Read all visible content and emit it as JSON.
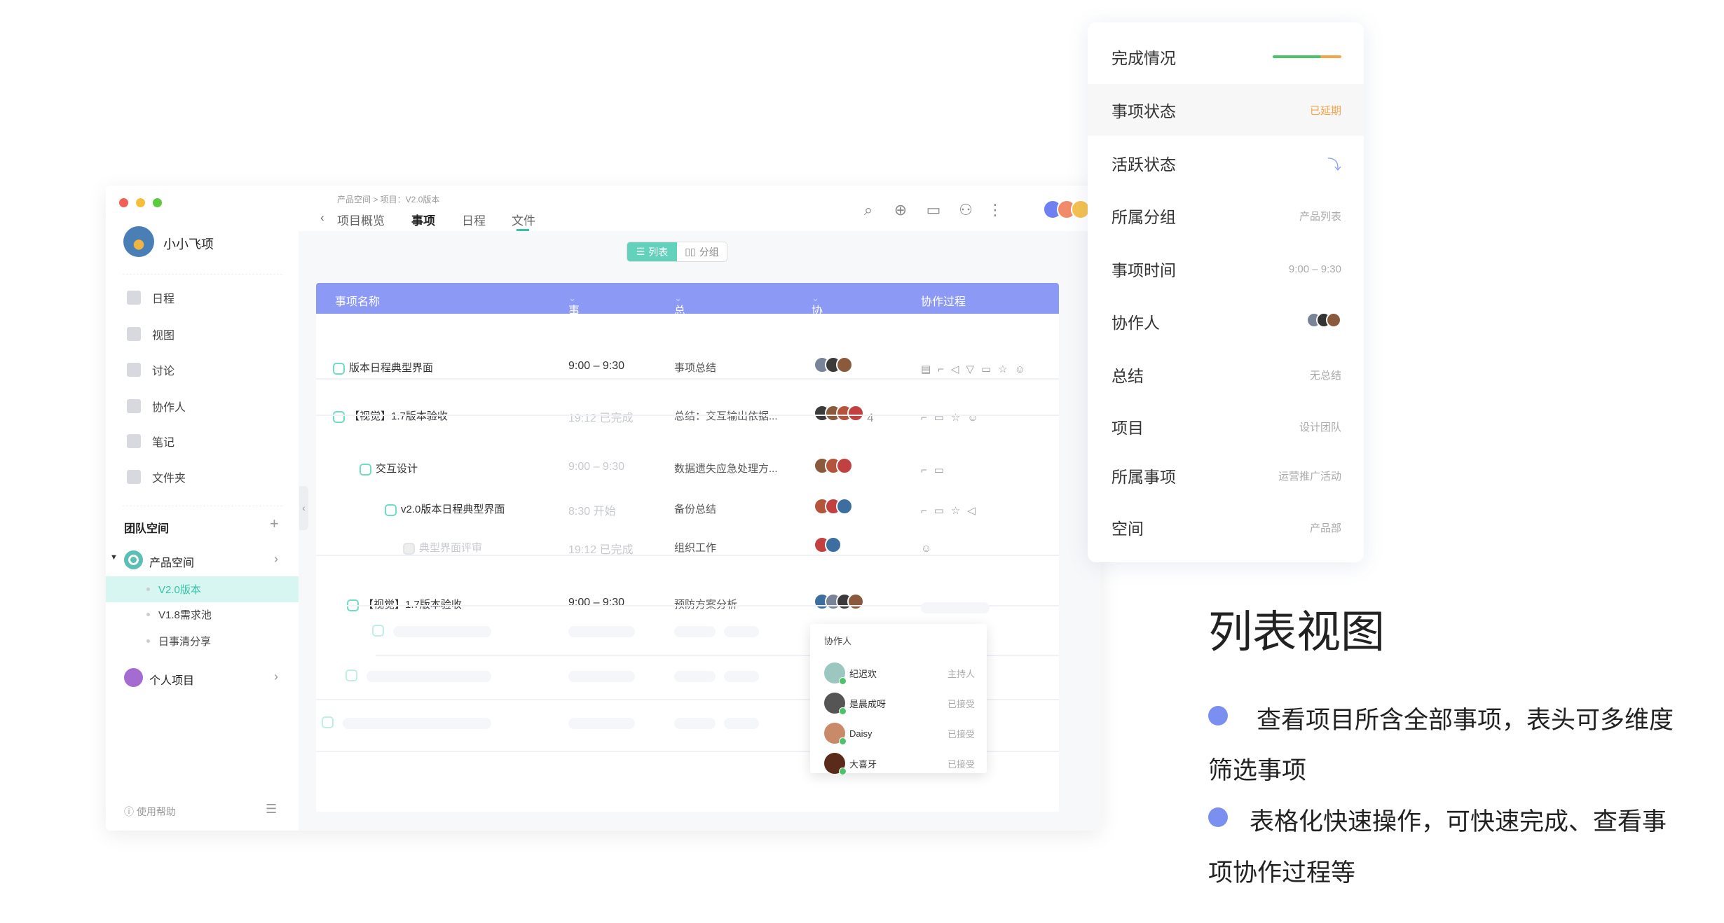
{
  "colors": {
    "accent": "#37c2a8",
    "header": "#8c9af5",
    "bullet": "#7b8ff0",
    "delayed": "#f5a54a"
  },
  "sidebar": {
    "user": "小小飞项",
    "nav": [
      {
        "label": "日程",
        "icon": "calendar-icon"
      },
      {
        "label": "视图",
        "icon": "chart-icon"
      },
      {
        "label": "讨论",
        "icon": "discussion-icon"
      },
      {
        "label": "协作人",
        "icon": "people-icon"
      },
      {
        "label": "笔记",
        "icon": "note-icon"
      },
      {
        "label": "文件夹",
        "icon": "folder-icon"
      }
    ],
    "team_title": "团队空间",
    "product_space": "产品空间",
    "sub": [
      "V2.0版本",
      "V1.8需求池",
      "日事清分享"
    ],
    "personal": "个人项目",
    "help": "使用帮助"
  },
  "header": {
    "breadcrumb": "产品空间 > 项目：V2.0版本",
    "tabs": [
      "项目概览",
      "事项",
      "日程",
      "文件"
    ],
    "active_tab": 1
  },
  "view_toggle": {
    "list": "列表",
    "group": "分组",
    "selected": "list"
  },
  "table": {
    "columns": [
      "事项名称",
      "事项时间",
      "总结",
      "协作人",
      "协作过程"
    ],
    "rows": [
      {
        "name": "版本日程典型界面",
        "time": "9:00 – 9:30",
        "time_muted": false,
        "summary": "事项总结",
        "avatars": 3,
        "extra": "",
        "icons": "▤⌐◁▽▭☆☺"
      },
      {
        "name": "【视觉】1.7版本验收",
        "time": "19:12 已完成",
        "time_muted": true,
        "summary": "总结：交互输出依据...",
        "avatars": 4,
        "extra": "4",
        "icons": "⌐▭☆☺"
      },
      {
        "name": "交互设计",
        "time": "9:00 – 9:30",
        "time_muted": true,
        "summary": "数据遗失应急处理方...",
        "avatars": 3,
        "extra": "",
        "icons": "⌐▭"
      },
      {
        "name": "v2.0版本日程典型界面",
        "time": "8:30 开始",
        "time_muted": true,
        "summary": "备份总结",
        "avatars": 3,
        "extra": "",
        "icons": "⌐▭☆◁"
      },
      {
        "name": "典型界面评审",
        "time": "19:12 已完成",
        "time_muted": true,
        "summary": "组织工作",
        "avatars": 2,
        "extra": "",
        "icons": "☺",
        "done": true
      },
      {
        "name": "【视觉】1.7版本验收",
        "time": "9:00 – 9:30",
        "time_muted": false,
        "summary": "预防方案分析",
        "avatars": 4,
        "extra": "",
        "icons": ""
      }
    ]
  },
  "popup": {
    "title": "协作人",
    "people": [
      {
        "name": "纪迟欢",
        "role": "主持人"
      },
      {
        "name": "是晨成呀",
        "role": "已接受"
      },
      {
        "name": "Daisy",
        "role": "已接受"
      },
      {
        "name": "大喜牙",
        "role": "已接受"
      }
    ]
  },
  "panel": {
    "progress": {
      "label": "完成情况",
      "complete_fraction": 0.7
    },
    "rows": [
      {
        "label": "事项状态",
        "value": "已延期"
      },
      {
        "label": "活跃状态",
        "value": ""
      },
      {
        "label": "所属分组",
        "value": "产品列表"
      },
      {
        "label": "事项时间",
        "value": "9:00 – 9:30"
      },
      {
        "label": "协作人",
        "value": ""
      },
      {
        "label": "总结",
        "value": "无总结"
      },
      {
        "label": "项目",
        "value": "设计团队"
      },
      {
        "label": "所属事项",
        "value": "运营推广活动"
      },
      {
        "label": "空间",
        "value": "产品部"
      }
    ]
  },
  "promo": {
    "title": "列表视图",
    "bullets": [
      [
        "查看项目所含全部事项，表头可多维度",
        "筛选事项"
      ],
      [
        "表格化快速操作，可快速完成、查看事",
        "项协作过程等"
      ]
    ]
  }
}
